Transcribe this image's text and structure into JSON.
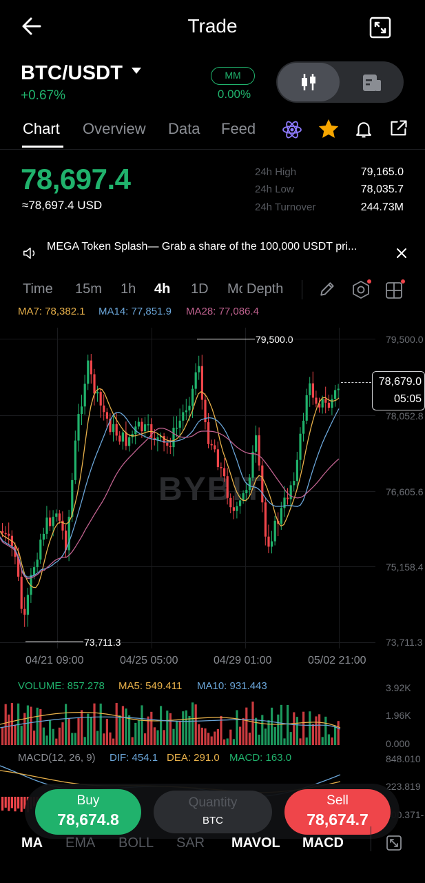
{
  "header": {
    "title": "Trade"
  },
  "pair": {
    "name": "BTC/USDT",
    "change": "+0.67%",
    "mm_label": "MM",
    "mm_value": "0.00%"
  },
  "tabs": [
    "Chart",
    "Overview",
    "Data",
    "Feed"
  ],
  "price": {
    "last": "78,697.4",
    "fiat": "≈78,697.4 USD"
  },
  "stats": [
    {
      "label": "24h High",
      "value": "79,165.0"
    },
    {
      "label": "24h Low",
      "value": "78,035.7"
    },
    {
      "label": "24h Turnover",
      "value": "244.73M"
    }
  ],
  "announcement": "MEGA Token Splash— Grab  a share of the 100,000 USDT pri...",
  "timeframes": [
    "Time",
    "15m",
    "1h",
    "4h",
    "1D",
    "Mo",
    "Depth"
  ],
  "ma_legend": {
    "ma7": "MA7: 78,382.1",
    "ma14": "MA14: 77,851.9",
    "ma28": "MA28: 77,086.4"
  },
  "chart": {
    "y_ticks": [
      "79,500.0",
      "78,052.8",
      "76,605.6",
      "75,158.4",
      "73,711.3"
    ],
    "x_ticks": [
      "04/21 09:00",
      "04/25 05:00",
      "04/29 01:00",
      "05/02 21:00"
    ],
    "high_marker": "79,500.0",
    "low_marker": "73,711.3",
    "current_price": "78,679.0",
    "countdown": "05:05",
    "watermark": "BYBIT"
  },
  "chart_data": {
    "type": "candlestick",
    "ylim": [
      73711.3,
      79500.0
    ],
    "max_label": "79,500.0",
    "min_label": "73,711.3",
    "last": "78,679.0"
  },
  "volume": {
    "legend": {
      "vol": "VOLUME: 857.278",
      "ma5": "MA5: 549.411",
      "ma10": "MA10: 931.443"
    },
    "y_ticks": [
      "3.92K",
      "1.96K",
      "0.000"
    ]
  },
  "macd": {
    "legend": {
      "params": "MACD(12, 26, 9)",
      "dif": "DIF: 454.1",
      "dea": "DEA: 291.0",
      "macd": "MACD: 163.0"
    },
    "y_ticks": [
      "848.010",
      "223.819",
      "-400.371"
    ]
  },
  "trade": {
    "buy_label": "Buy",
    "buy_price": "78,674.8",
    "qty_label": "Quantity",
    "qty_unit": "BTC",
    "sell_label": "Sell",
    "sell_price": "78,674.7"
  },
  "indicators": [
    "MA",
    "EMA",
    "BOLL",
    "SAR",
    "MAVOL",
    "MACD"
  ],
  "colors": {
    "green": "#20b26c",
    "red": "#ef454a",
    "ma7": "#e7b04a",
    "ma14": "#6aa5d8",
    "ma28": "#c0628f"
  }
}
